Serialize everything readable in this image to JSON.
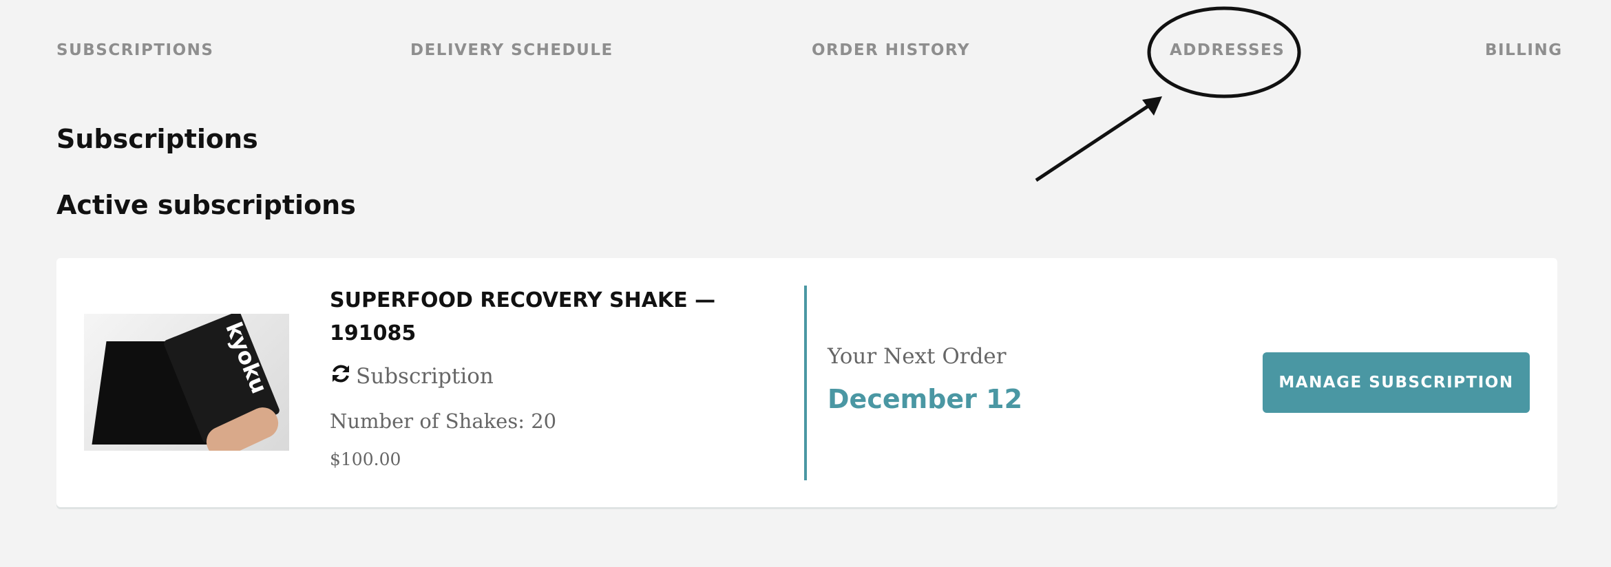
{
  "nav": {
    "tabs": [
      {
        "label": "SUBSCRIPTIONS"
      },
      {
        "label": "DELIVERY SCHEDULE"
      },
      {
        "label": "ORDER HISTORY"
      },
      {
        "label": "ADDRESSES"
      },
      {
        "label": "BILLING"
      }
    ]
  },
  "page": {
    "title": "Subscriptions",
    "section_title": "Active subscriptions"
  },
  "subscription": {
    "product_title": "SUPERFOOD RECOVERY SHAKE — 191085",
    "image_brand_text": "kyoku",
    "type_icon": "refresh-icon",
    "type_label": "Subscription",
    "quantity": "Number of Shakes: 20",
    "price": "$100.00",
    "next_order_label": "Your Next Order",
    "next_order_date": "December 12",
    "manage_label": "MANAGE SUBSCRIPTION"
  },
  "colors": {
    "accent": "#4a97a3",
    "background": "#f3f3f3",
    "tab_text": "#8e8e8e"
  }
}
